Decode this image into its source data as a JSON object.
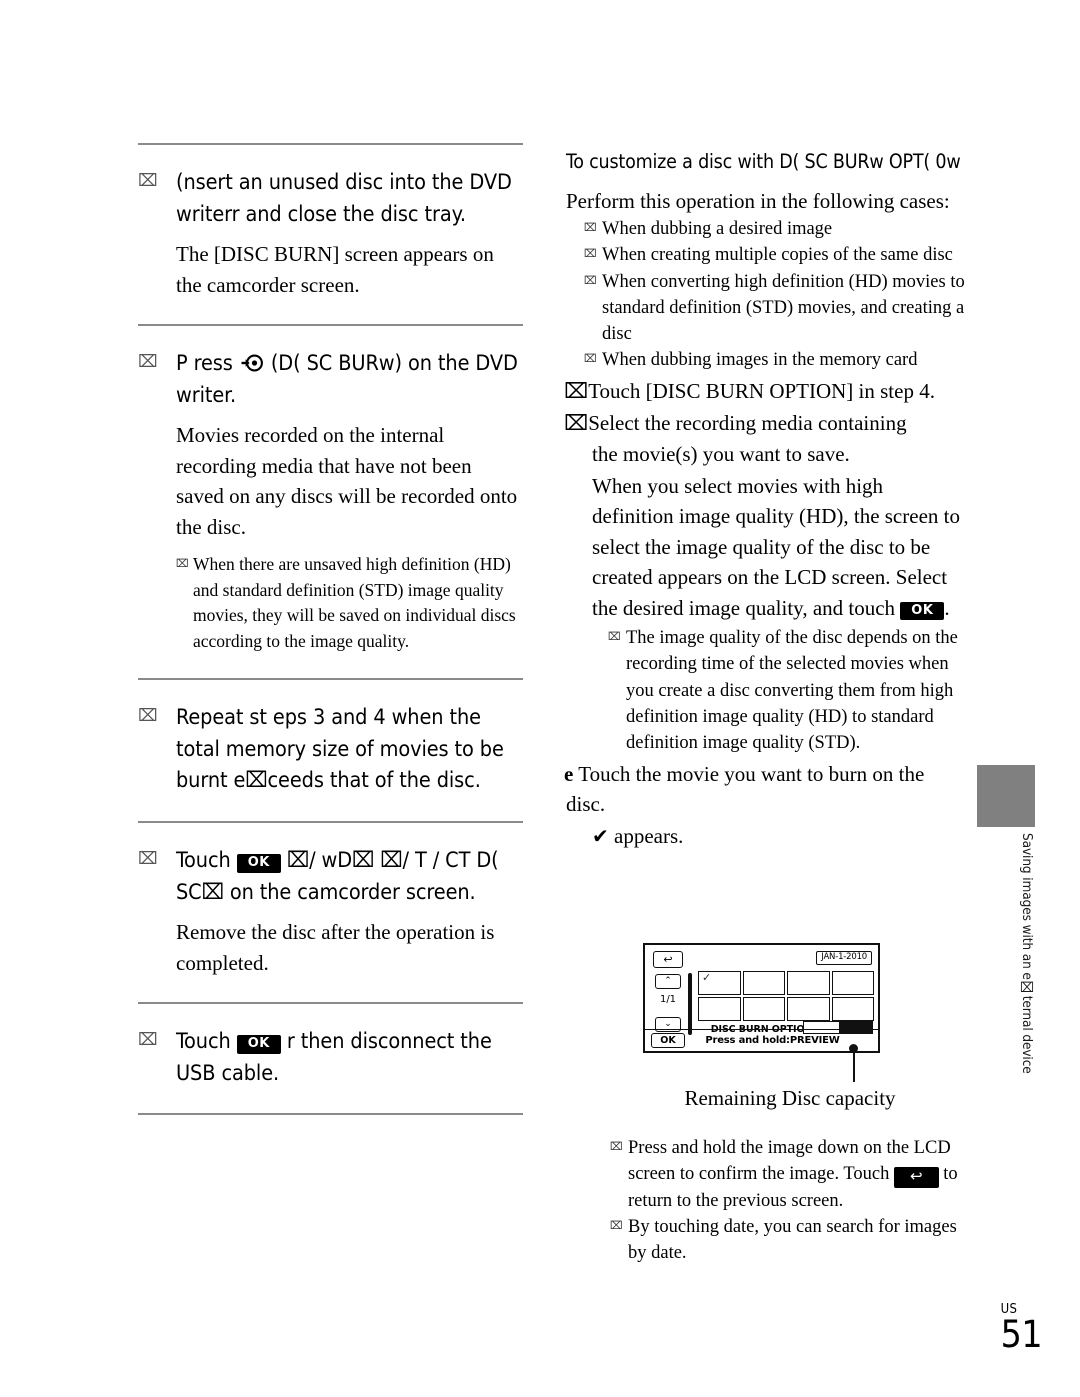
{
  "page": {
    "number": "51",
    "region_code": "US"
  },
  "side_tab": {
    "label": "Saving images with an e⌧ternal device"
  },
  "left_column": {
    "steps": [
      {
        "marker": "⌧",
        "heading": "(nsert an unused disc into the DVD writerr  and close the disc tray.",
        "description": "The [DISC BURN] screen appears on the camcorder screen.",
        "notes": []
      },
      {
        "marker": "⌧",
        "heading_pre": "P ress",
        "heading_icon": "disc-burn-icon",
        "heading_post": "(D( SC BURw) on the DVD writer.",
        "description": "Movies recorded on the internal recording media that have not been saved on any discs will be recorded onto the disc.",
        "notes": [
          {
            "mark": "⌧",
            "text": "When there are unsaved high definition (HD) and standard definition (STD) image quality movies, they will be saved on individual discs according to the image quality."
          }
        ]
      },
      {
        "marker": "⌧",
        "heading": "Repeat st    eps 3 and 4 when the total memory size of movies to be burnt e⌧ceeds that of the disc.",
        "description": "",
        "notes": []
      },
      {
        "marker": "⌧",
        "heading_pre": "Touch",
        "heading_button": "OK",
        "heading_post": "⌧/ wD⌧ ⌧/ T / CT D( SC⌧ on the camcorder screen.",
        "description": "Remove the disc after the operation is completed.",
        "notes": []
      },
      {
        "marker": "⌧",
        "heading_pre": "Touch",
        "heading_button": "OK",
        "heading_post": "r  then disconnect the USB cable.",
        "description": "",
        "notes": []
      }
    ]
  },
  "right_column": {
    "section_heading": "To customize a disc with D( SC BURw OPT( 0w",
    "intro": "Perform this operation in the following cases:",
    "case_notes": [
      {
        "mark": "⌧",
        "text": "When dubbing a desired image"
      },
      {
        "mark": "⌧",
        "text": "When creating multiple copies of the same disc"
      },
      {
        "mark": "⌧",
        "text": "When converting high definition (HD) movies to standard definition (STD) movies, and creating a disc"
      },
      {
        "mark": "⌧",
        "text": "When dubbing images in the memory card"
      }
    ],
    "step_touch_option": "⌧Touch [DISC BURN OPTION] in step 4.",
    "step_select_media": "⌧Select the recording media containing",
    "step_select_media_cont": "the movie(s) you want to save.",
    "select_para_pre": "When you select movies with high definition image quality (HD), the screen to select the image quality of the disc to be created appears on the LCD screen. Select the desired image quality, and touch",
    "select_para_button": "OK",
    "select_para_post": ".",
    "quality_note": {
      "mark": "⌧",
      "text": "The image quality of the disc depends on the recording time of the selected movies when you create a disc converting them from high definition image quality (HD) to standard definition image quality (STD)."
    },
    "step_touch_movie_marker": "e",
    "step_touch_movie": "Touch the movie you want to burn on the disc.",
    "appears_glyph": "✔",
    "appears_text": "appears.",
    "figure_caption": "Remaining Disc capacity",
    "bottom_notes": [
      {
        "mark": "⌧",
        "pre": "Press and hold the image down on the LCD screen to confirm the image. Touch",
        "button": "↩",
        "post": "to return to the previous screen."
      },
      {
        "mark": "⌧",
        "pre": "By touching date, you can search for images by date.",
        "button": "",
        "post": ""
      }
    ]
  },
  "lcd_screen": {
    "back_button": "↩",
    "date_badge": "JAN-1-2010",
    "up_arrow": "⌃",
    "down_arrow": "⌄",
    "page_indicator": "1/1",
    "selected_tick": "✓",
    "option_label": "DISC BURN OPTION",
    "ok_button": "OK",
    "hold_hint": "Press and hold:PREVIEW",
    "capacity_used_percent": 48
  },
  "colors": {
    "rule": "#8a8a8a",
    "tab_block": "#808080",
    "ink": "#000000",
    "button_bg": "#000000",
    "button_fg": "#ffffff"
  }
}
